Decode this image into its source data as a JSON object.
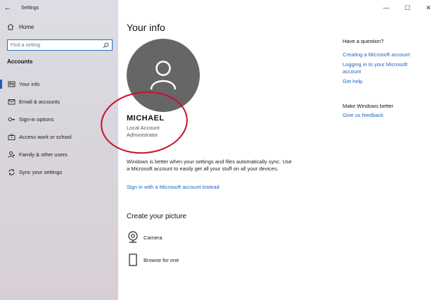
{
  "window": {
    "app_title": "Settings",
    "controls": {
      "minimize": "—",
      "maximize": "☐",
      "close": "✕"
    }
  },
  "sidebar": {
    "back_glyph": "←",
    "home_label": "Home",
    "search": {
      "placeholder": "Find a setting"
    },
    "section_heading": "Accounts",
    "items": [
      {
        "label": "Your info",
        "icon": "person-card-icon",
        "active": true
      },
      {
        "label": "Email & accounts",
        "icon": "mail-icon",
        "active": false
      },
      {
        "label": "Sign-in options",
        "icon": "key-icon",
        "active": false
      },
      {
        "label": "Access work or school",
        "icon": "briefcase-icon",
        "active": false
      },
      {
        "label": "Family & other users",
        "icon": "person-add-icon",
        "active": false
      },
      {
        "label": "Sync your settings",
        "icon": "sync-icon",
        "active": false
      }
    ]
  },
  "main": {
    "title": "Your info",
    "user": {
      "name": "MICHAEL",
      "account_type": "Local Account",
      "role": "Administrator"
    },
    "sync_text": "Windows is better when your settings and files automatically sync. Use a Microsoft account to easily get all your stuff on all your devices.",
    "ms_account_link": "Sign in with a Microsoft account instead",
    "create_picture": {
      "title": "Create your picture",
      "options": [
        {
          "label": "Camera",
          "icon": "camera-icon"
        },
        {
          "label": "Browse for one",
          "icon": "browse-file-icon"
        }
      ]
    }
  },
  "right_column": {
    "question_heading": "Have a question?",
    "question_links": [
      "Creating a Microsoft account",
      "Logging in to your Microsoft account",
      "Get help"
    ],
    "feedback_heading": "Make Windows better",
    "feedback_link": "Give us feedback"
  },
  "colors": {
    "accent": "#1f64c0",
    "avatar_bg": "#666666",
    "annotation_circle": "#c8102e"
  }
}
